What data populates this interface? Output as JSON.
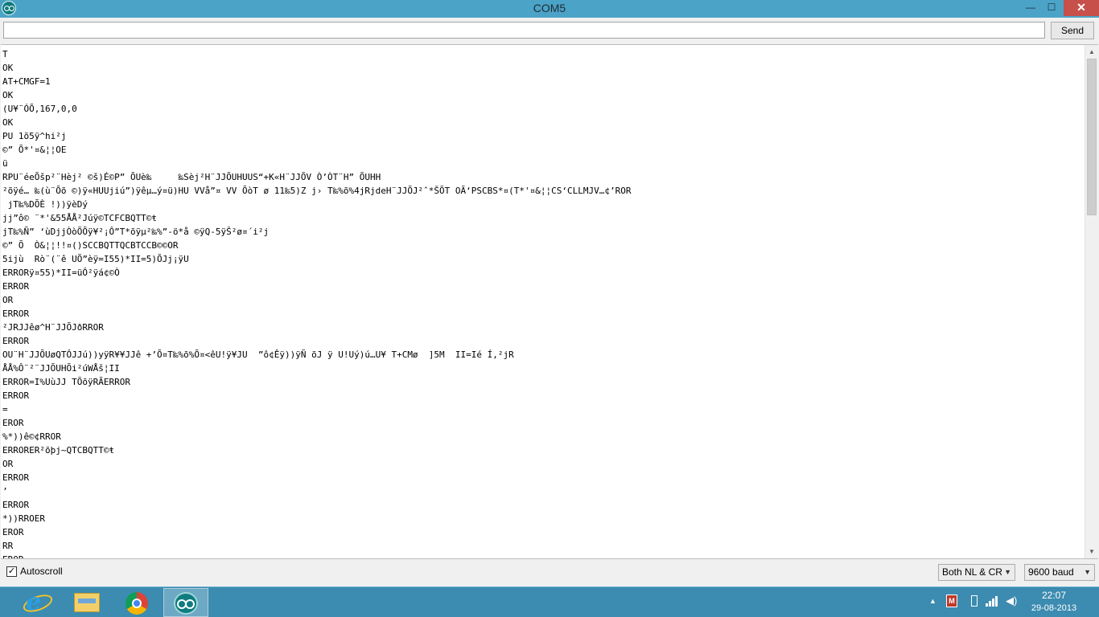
{
  "window": {
    "title": "COM5",
    "minimize_glyph": "—",
    "maximize_glyph": "☐",
    "close_glyph": "✕"
  },
  "input": {
    "value": "",
    "send_label": "Send"
  },
  "output": {
    "lines": [
      "T",
      "OK",
      "AT+CMGF=1",
      "OK",
      "(U¥¨ÓÕ,167,0,0",
      "OK",
      "PU 1õ5ÿ^hi²j",
      "©” Õ*'¤&¦¦OE",
      "ü",
      "RPU¨éeÕšp²¨Hèj² ©š)É©P” ÕUè‰     ‰Sèj²H¨JJÕUHUUS“+K«H¨JJÕV Ò’ÒT¨H” ÕUHH",
      "²õÿé… ‰(ù¨Õõ ©)ÿ«HUUjiú”)ÿêµ…ý¤ü)HU VVå”¤ VV ÕòT ø 11‰5)Z j› T‰%õ%4jRjdeH¨JJÕJ²ˆ*ŠÕT OÃ‘PSCBS*¤(T*'¤&¦¦CS‘CLLMJV…¢’ROR",
      " jT‰%DÕÈ !))ÿèDý",
      "jj”ô© ¨*'&55ÅÅ²Júÿ©TCFCBQTT©ŧ",
      "jT‰%Ñ” ‘ùDjjÒòÕÕÿ¥²¡Ô”T*õÿµ²‰%”-ö*å ©ÿQ-5ÿŠ²ø¤´i²j",
      "©” Õ  Ò&¦¦!!¤()SCCBQTTQCBTCCB©©OR",
      "5ijù  Rò¨(¨ê UÕ”èÿ=I55)*II=5)ÕJj¡ÿU",
      "ERRORÿ¤55)*II=üÔ²ÿá¢©Ò",
      "ERROR",
      "OR",
      "ERROR",
      "²JRJJêø^H¨JJÕJðRROR",
      "ERROR",
      "OU¨H¨JJÕUøQTÔJJú))yÿR¥¥JJê +’Õ¤T‰%õ%Õ¤<êU!ÿ¥JU  ”ô¢Êÿ))ÿÑ õJ ÿ U!Uý)ú…U¥ T+CMø  ]5M  II=Ié Í,²jR",
      "ÅÅ%Ô¨²¨JJÕUHÕi²úWÅš¦II",
      "ERROR=I%UùJJ TÕõÿRÃERROR",
      "ERROR",
      "=",
      "EROR",
      "%*))ê©¢RROR",
      "ERRORER²õþj~QTCBQTT©ŧ",
      "OR",
      "ERROR",
      "’",
      "ERROR",
      "*))RROER",
      "EROR",
      "RR",
      "EROR"
    ]
  },
  "footer": {
    "autoscroll_checked_glyph": "✓",
    "autoscroll_label": "Autoscroll",
    "line_ending": "Both NL & CR",
    "baud_rate": "9600 baud"
  },
  "taskbar": {
    "time": "22:07",
    "date": "29-08-2013"
  }
}
